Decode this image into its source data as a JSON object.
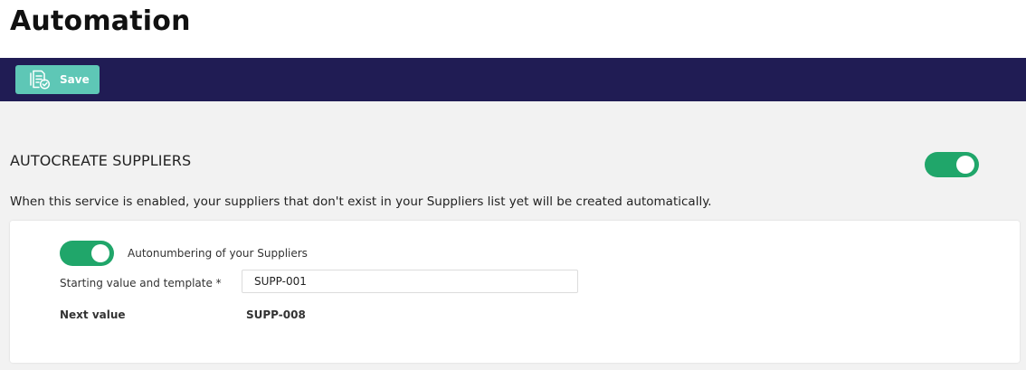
{
  "header": {
    "title": "Automation"
  },
  "toolbar": {
    "save_label": "Save",
    "save_icon": "save-document-check-icon",
    "background_color": "#201c54",
    "button_color": "#5ec7b6"
  },
  "section": {
    "title": "AUTOCREATE SUPPLIERS",
    "enabled": true,
    "description": "When this service is enabled, your suppliers that don't exist in your Suppliers list yet will be created automatically.",
    "toggle_color": "#20a66a"
  },
  "autonumbering": {
    "enabled": true,
    "label": "Autonumbering of your Suppliers",
    "start_label": "Starting value and template *",
    "start_value": "SUPP-001",
    "next_label": "Next value",
    "next_value": "SUPP-008"
  }
}
